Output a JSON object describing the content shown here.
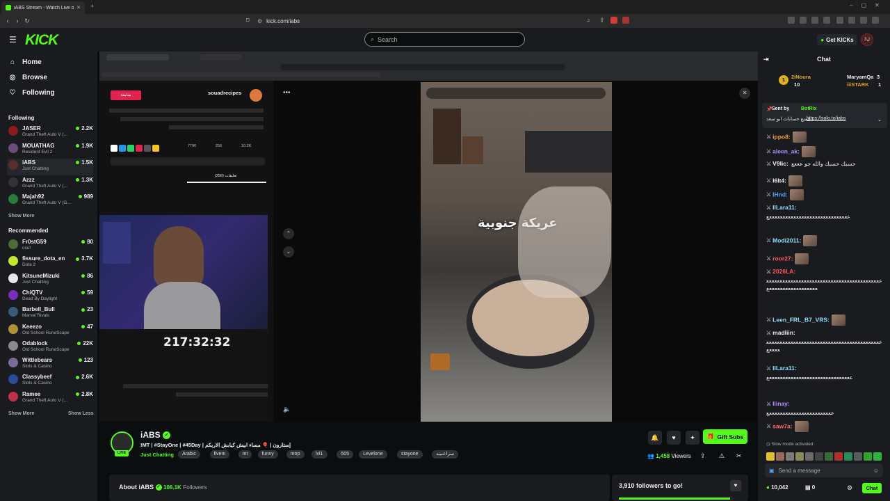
{
  "browser": {
    "tab_title": "iABS Stream - Watch Live on Kick",
    "url": "kick.com/iabs"
  },
  "topnav": {
    "logo": "KICK",
    "search_placeholder": "Search",
    "get_kicks": "Get KICKs",
    "avatar_text": "3ل"
  },
  "sidebar": {
    "nav": [
      {
        "label": "Home",
        "icon": "home-icon"
      },
      {
        "label": "Browse",
        "icon": "compass-icon"
      },
      {
        "label": "Following",
        "icon": "heart-icon"
      }
    ],
    "following_header": "Following",
    "following": [
      {
        "name": "JASER",
        "game": "Grand Theft Auto V (...",
        "viewers": "2.2K",
        "color": "#8b1c1c"
      },
      {
        "name": "MOUATHAG",
        "game": "Resident Evil 2",
        "viewers": "1.9K",
        "color": "#6a4d7a"
      },
      {
        "name": "iABS",
        "game": "Just Chatting",
        "viewers": "1.5K",
        "color": "#5b2c2c"
      },
      {
        "name": "Azzz",
        "game": "Grand Theft Auto V (...",
        "viewers": "1.3K",
        "color": "#333333"
      },
      {
        "name": "Majah92",
        "game": "Grand Theft Auto V (G...",
        "viewers": "989",
        "color": "#2c7a3c"
      }
    ],
    "show_more_1": "Show More",
    "recommended_header": "Recommended",
    "recommended": [
      {
        "name": "Fr0stG59",
        "game": "osu!",
        "viewers": "80",
        "color": "#4a6b3a"
      },
      {
        "name": "fissure_dota_en",
        "game": "Dota 2",
        "viewers": "3.7K",
        "color": "#c4e82c"
      },
      {
        "name": "KitsuneMizuki",
        "game": "Just Chatting",
        "viewers": "86",
        "color": "#e8e8e8"
      },
      {
        "name": "ChiQTV",
        "game": "Dead By Daylight",
        "viewers": "59",
        "color": "#7a2cba"
      },
      {
        "name": "Barbell_Bull",
        "game": "Marvel Rivals",
        "viewers": "23",
        "color": "#3a5a7a"
      },
      {
        "name": "Keeezo",
        "game": "Old School RuneScape",
        "viewers": "47",
        "color": "#b0903a"
      },
      {
        "name": "Odablock",
        "game": "Old School RuneScape",
        "viewers": "22K",
        "color": "#8a8a8a"
      },
      {
        "name": "Wittlebears",
        "game": "Slots & Casino",
        "viewers": "123",
        "color": "#7a6a9a"
      },
      {
        "name": "Classybeef",
        "game": "Slots & Casino",
        "viewers": "2.6K",
        "color": "#2a4a9a"
      },
      {
        "name": "Ramee",
        "game": "Grand Theft Auto V (...",
        "viewers": "2.8K",
        "color": "#c0304a"
      }
    ],
    "show_more_2": "Show More",
    "show_less": "Show Less"
  },
  "video": {
    "timer": "217:32:32",
    "food_caption": "عريكة جنوبية",
    "profile_name": "souadrecipes",
    "follow_btn": "متابعة",
    "comments_tab": "(256) تعليقات",
    "likes": "7796",
    "comments": "256",
    "shares": "10.2K"
  },
  "channel": {
    "name": "iABS",
    "title": "!MT | #StayOne | #45Day | إستارون | 🎈 مساء ابيش كيابش الاربكم",
    "category": "Just Chatting",
    "tags": [
      "Arabic",
      "fivem",
      "mt",
      "funny",
      "mtrp",
      "lvl1",
      "505",
      "Levelone",
      "stayone",
      "سراعـينه"
    ],
    "live": "LIVE",
    "gift_subs": "Gift Subs",
    "viewers_count": "1,458",
    "viewers_label": "Viewers",
    "about_label": "About iABS",
    "followers_count": "106.1K",
    "followers_label": "Followers",
    "goal_text": "3,910 followers to go!"
  },
  "chat": {
    "header": "Chat",
    "pinned_users": [
      {
        "name": "2iNoura",
        "count": "10"
      },
      {
        "name": "MaryamQa",
        "count": "3"
      },
      {
        "name": "iiiSTARK",
        "count": "1"
      }
    ],
    "pinned_sender": "Sent by",
    "pinned_bot": "BotRix",
    "pinned_msg": "جميع حسابات ابو سعد",
    "pinned_link": "https://solo.to/iabs",
    "messages": [
      {
        "user": "ippo8:",
        "color": "#ff9a3c",
        "text": ""
      },
      {
        "user": "aleen_ak:",
        "color": "#b98cff",
        "text": ""
      },
      {
        "user": "V9lic:",
        "color": "#efeff1",
        "text": "حسبك حسبك والله جو عععع"
      },
      {
        "user": "l6lt4:",
        "color": "#efeff1",
        "text": ""
      },
      {
        "user": "lHnd:",
        "color": "#5aa0ff",
        "text": ""
      },
      {
        "user": "llLara11:",
        "color": "#8fe0ff",
        "text": "ععععععععععععععععععععععععععععععع"
      },
      {
        "user": "Modi2011:",
        "color": "#8fe0ff",
        "text": ""
      },
      {
        "user": "roor27:",
        "color": "#ff5a5a",
        "text": ""
      },
      {
        "user": "2026LA:",
        "color": "#ff5a5a",
        "text": "عععععععععععععععععععععععععععععععععععععععععععععععععععععععععععععع"
      },
      {
        "user": "Leen_FRL_B7_VRS:",
        "color": "#8fe0ff",
        "text": ""
      },
      {
        "user": "madliin:",
        "color": "#efeff1",
        "text": "عععععععععععععععععععععععععععععععععععععععععععععععع"
      },
      {
        "user": "llLara11:",
        "color": "#8fe0ff",
        "text": "عععععععععععععععععععععععععععععععع"
      },
      {
        "user": "llinay:",
        "color": "#b98cff",
        "text": "ععععععععععععععععععععععععع"
      },
      {
        "user": "saw7a:",
        "color": "#ff6a6a",
        "text": ""
      }
    ],
    "slow_mode": "Slow mode activated",
    "send_placeholder": "Send a message",
    "kicks_balance": "10,042",
    "gift_count": "0",
    "chat_button": "Chat",
    "colors": {
      "accent": "#53fc18",
      "bg": "#191b1f"
    }
  }
}
